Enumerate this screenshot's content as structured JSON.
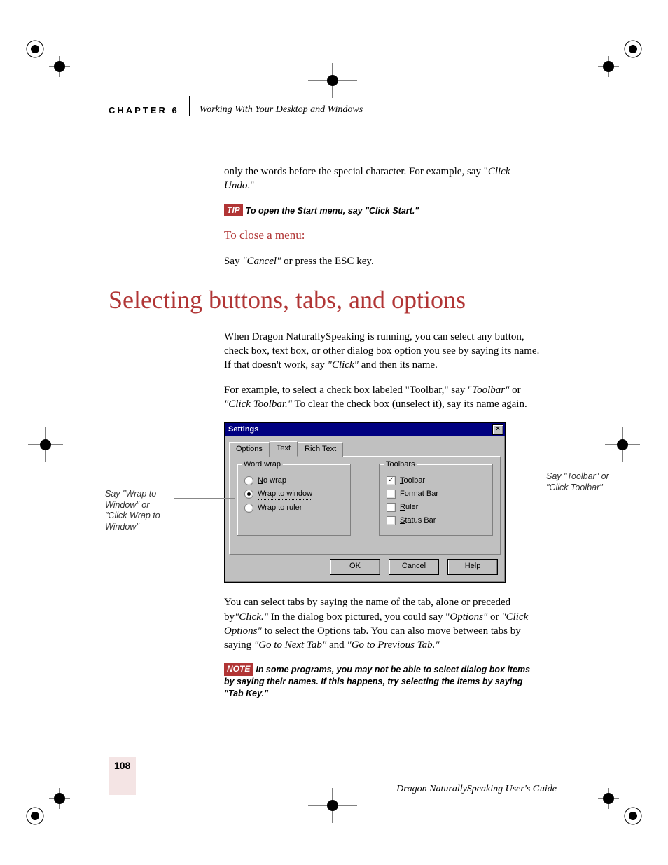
{
  "header": {
    "chapter_label": "CHAPTER 6",
    "chapter_title": "Working With Your Desktop and Windows"
  },
  "intro_para": {
    "pre": "only the words before the special character. For example, say \"",
    "em": "Click Undo",
    "post": ".\""
  },
  "tip": {
    "badge": "TIP",
    "text": "To open the Start menu, say \"Click Start.\""
  },
  "close_menu": {
    "heading": "To close a menu:",
    "pre": "Say ",
    "em": "\"Cancel\"",
    "mid": " or press the ",
    "key": "ESC",
    "post": " key."
  },
  "section_title": "Selecting buttons, tabs, and options",
  "para1": {
    "pre": "When Dragon NaturallySpeaking is running, you can select any button, check box, text box, or other dialog box option you see by saying its name. If that doesn't work, say ",
    "em": "\"Click\"",
    "post": " and then its name."
  },
  "para2": {
    "pre": "For example, to select a check box labeled \"Toolbar,\" say \"",
    "em1": "Toolbar\"",
    "mid": " or ",
    "em2": "\"Click Toolbar.\"",
    "post": " To clear the check box (unselect it), say its name again."
  },
  "dialog": {
    "title": "Settings",
    "tabs": {
      "options": "Options",
      "text": "Text",
      "rich": "Rich Text"
    },
    "wordwrap": {
      "legend": "Word wrap",
      "nowrap": "No wrap",
      "towindow": "Wrap to window",
      "toruler": "Wrap to ruler"
    },
    "toolbars": {
      "legend": "Toolbars",
      "toolbar": "Toolbar",
      "format": "Format Bar",
      "ruler": "Ruler",
      "status": "Status Bar"
    },
    "buttons": {
      "ok": "OK",
      "cancel": "Cancel",
      "help": "Help"
    }
  },
  "callouts": {
    "left": "Say \"Wrap to Window\" or \"Click Wrap to Window\"",
    "right": "Say \"Toolbar\" or \"Click Toolbar\""
  },
  "para3": {
    "pre": "You can select tabs by saying the name of the tab, alone or preceded by",
    "em1": "\"Click.\"",
    "mid1": " In the dialog box pictured, you could say \"",
    "em2": "Options\"",
    "mid2": " or ",
    "em3": "\"Click Options\"",
    "mid3": " to select the Options tab. You can also move between tabs by saying ",
    "em4": "\"Go to Next Tab\"",
    "mid4": " and ",
    "em5": "\"Go to Previous Tab.\""
  },
  "note": {
    "badge": "NOTE",
    "text": "In some programs, you may not be able to select dialog box items by saying their names. If this happens, try selecting the items by saying \"Tab Key.\""
  },
  "footer": {
    "page": "108",
    "title": "Dragon NaturallySpeaking User's Guide"
  }
}
